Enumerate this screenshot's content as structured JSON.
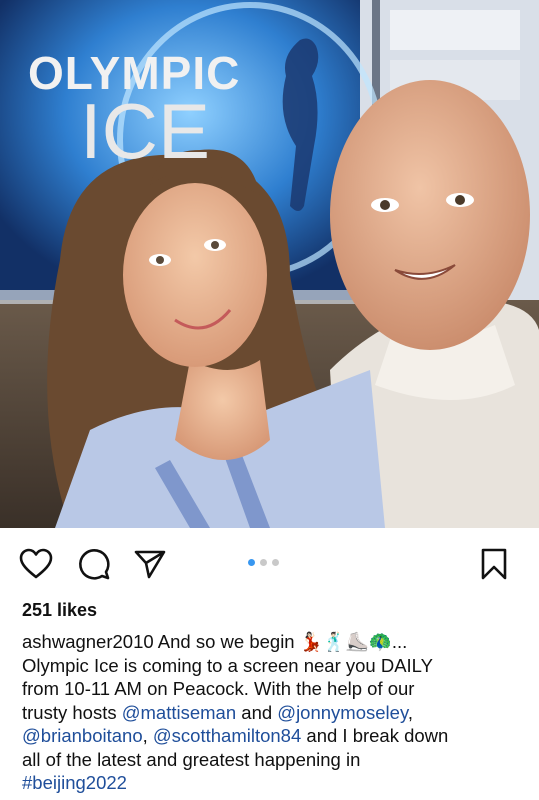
{
  "post": {
    "image": {
      "logo_line1": "OLYMPIC",
      "logo_line2": "ICE"
    },
    "carousel": {
      "total": 3,
      "active": 1
    },
    "likes": "251 likes",
    "caption": {
      "username": "ashwagner2010",
      "line1_text": "And so we begin 💃🏻🕺🏻⛸️🦚...",
      "line2": "Olympic Ice is coming to a screen near you DAILY",
      "line3": "from 10-11 AM on Peacock. With the help of our",
      "line4_pre": "trusty hosts ",
      "mention1": "@mattiseman",
      "line4_mid": " and ",
      "mention2": "@jonnymoseley",
      "line4_post": ",",
      "mention3": "@brianboitano",
      "line5_mid": ", ",
      "mention4": "@scotthamilton84",
      "line5_post": " and I break down",
      "line6": "all of the latest and greatest happening in",
      "hashtag": "#beijing2022"
    }
  },
  "icons": {
    "like": "heart-icon",
    "comment": "comment-icon",
    "share": "share-icon",
    "save": "bookmark-icon"
  },
  "colors": {
    "link": "#1f4e9a",
    "carousel_active": "#3897f0",
    "carousel_inactive": "#c9c9c9"
  }
}
